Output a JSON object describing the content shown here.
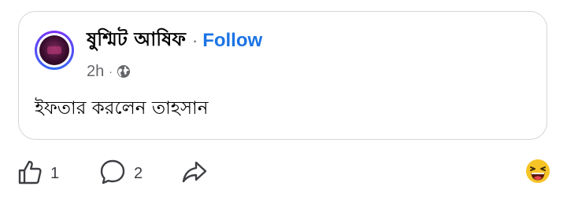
{
  "post": {
    "author": "ষুশ্মিট আষিফ",
    "separator": "·",
    "follow_label": "Follow",
    "time": "2h",
    "meta_separator": "·",
    "audience_icon": "globe-icon",
    "text": "ইফতার করলেন তাহসান"
  },
  "actions": {
    "like_count": "1",
    "comment_count": "2",
    "like_icon": "thumbs-up-icon",
    "comment_icon": "comment-bubble-icon",
    "share_icon": "share-arrow-icon",
    "reaction_icon": "laughing-emoji-icon"
  },
  "colors": {
    "follow": "#1b74e4",
    "text": "#050505",
    "meta": "#65676b",
    "card_border": "#d3d5d9"
  }
}
